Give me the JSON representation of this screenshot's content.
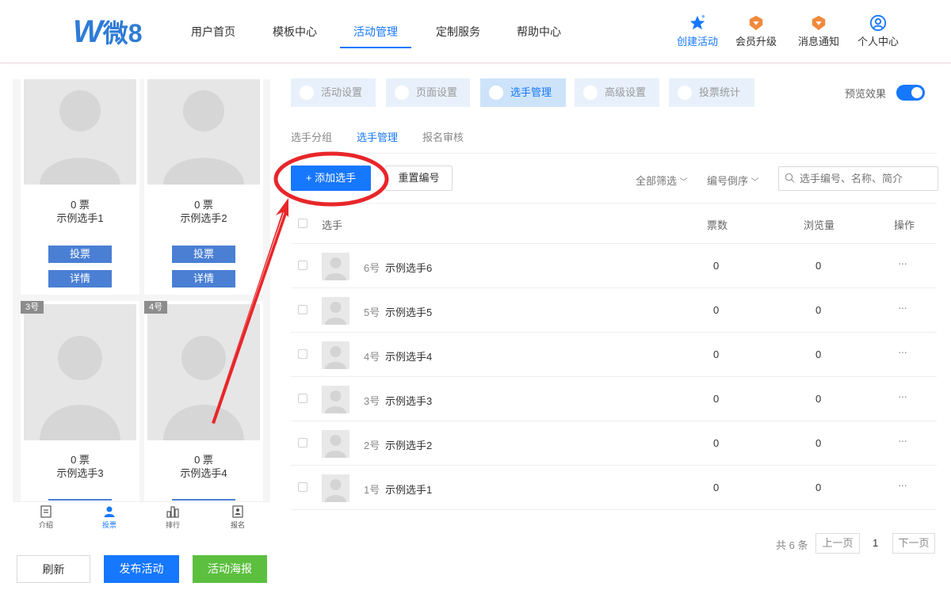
{
  "header": {
    "logo_w": "W",
    "logo_text": "微8",
    "nav": [
      {
        "label": "用户首页"
      },
      {
        "label": "模板中心"
      },
      {
        "label": "活动管理"
      },
      {
        "label": "定制服务"
      },
      {
        "label": "帮助中心"
      }
    ],
    "right": [
      {
        "label": "创建活动",
        "icon": "star-icon"
      },
      {
        "label": "会员升级",
        "icon": "member-badge-icon"
      },
      {
        "label": "消息通知",
        "icon": "notification-badge-icon"
      },
      {
        "label": "个人中心",
        "icon": "user-icon"
      }
    ]
  },
  "preview": {
    "cards": [
      {
        "votes": "0 票",
        "name": "示例选手1",
        "vote_btn": "投票",
        "detail_btn": "详情"
      },
      {
        "votes": "0 票",
        "name": "示例选手2",
        "vote_btn": "投票",
        "detail_btn": "详情"
      },
      {
        "badge": "3号",
        "votes": "0 票",
        "name": "示例选手3"
      },
      {
        "badge": "4号",
        "votes": "0 票",
        "name": "示例选手4"
      }
    ],
    "tabbar": [
      {
        "label": "介绍",
        "icon": "intro-icon"
      },
      {
        "label": "投票",
        "icon": "vote-user-icon"
      },
      {
        "label": "排行",
        "icon": "ranking-icon"
      },
      {
        "label": "报名",
        "icon": "signup-icon"
      }
    ],
    "buttons": {
      "refresh": "刷新",
      "publish": "发布活动",
      "poster": "活动海报"
    }
  },
  "main": {
    "top_tabs": [
      {
        "label": "活动设置"
      },
      {
        "label": "页面设置"
      },
      {
        "label": "选手管理"
      },
      {
        "label": "高级设置"
      },
      {
        "label": "投票统计"
      }
    ],
    "preview_label": "预览效果",
    "sub_tabs": [
      {
        "label": "选手分组"
      },
      {
        "label": "选手管理"
      },
      {
        "label": "报名审核"
      }
    ],
    "toolbar": {
      "add": "+ 添加选手",
      "reset": "重置编号",
      "filter_all": "全部筛选",
      "sort": "编号倒序",
      "search_placeholder": "选手编号、名称、简介"
    },
    "table": {
      "headers": {
        "player": "选手",
        "votes": "票数",
        "views": "浏览量",
        "actions": "操作"
      },
      "rows": [
        {
          "num": "6号",
          "name": "示例选手6",
          "votes": "0",
          "views": "0",
          "more": "···"
        },
        {
          "num": "5号",
          "name": "示例选手5",
          "votes": "0",
          "views": "0",
          "more": "···"
        },
        {
          "num": "4号",
          "name": "示例选手4",
          "votes": "0",
          "views": "0",
          "more": "···"
        },
        {
          "num": "3号",
          "name": "示例选手3",
          "votes": "0",
          "views": "0",
          "more": "···"
        },
        {
          "num": "2号",
          "name": "示例选手2",
          "votes": "0",
          "views": "0",
          "more": "···"
        },
        {
          "num": "1号",
          "name": "示例选手1",
          "votes": "0",
          "views": "0",
          "more": "···"
        }
      ]
    },
    "pagination": {
      "total": "共 6 条",
      "prev": "上一页",
      "current": "1",
      "next": "下一页"
    }
  },
  "colors": {
    "primary": "#1677ff",
    "green": "#5cbf3f",
    "annotation": "#e8262a"
  }
}
